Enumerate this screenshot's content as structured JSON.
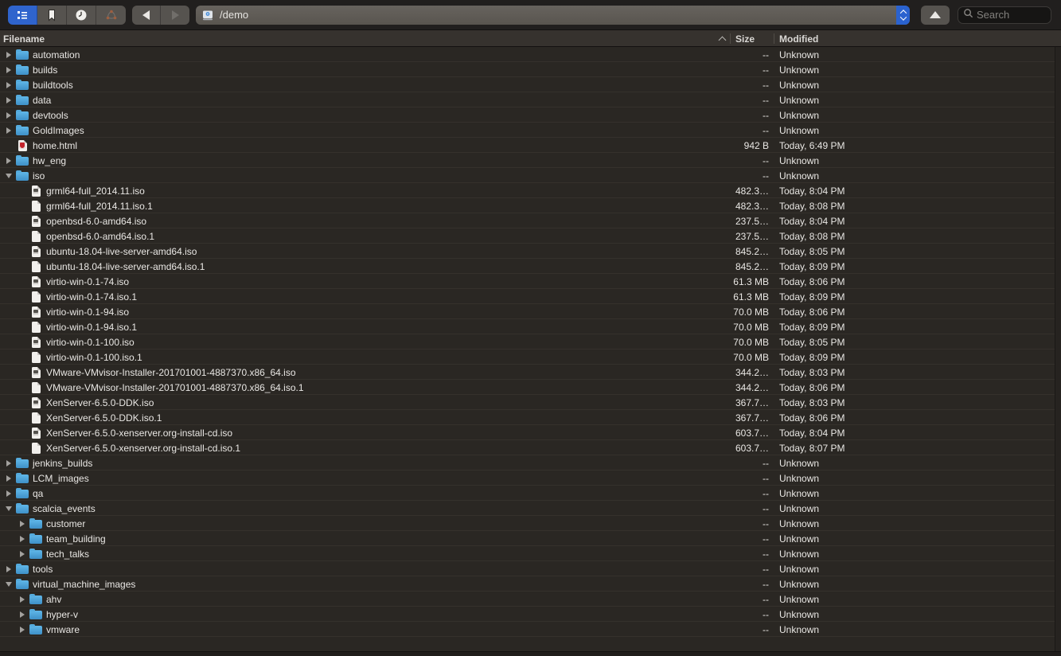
{
  "toolbar": {
    "view_buttons": [
      {
        "name": "outline-view",
        "selected": true
      },
      {
        "name": "bookmarks-view",
        "selected": false
      },
      {
        "name": "history-view",
        "selected": false
      },
      {
        "name": "network-view",
        "selected": false
      }
    ],
    "back_enabled": true,
    "forward_enabled": false,
    "path_value": "/demo",
    "search_placeholder": "Search"
  },
  "colors": {
    "accent_blue": "#2f64cd",
    "folder_blue": "#4aa3d8",
    "row_background": "#2a2723",
    "toolbar_background": "#211f1e",
    "html_badge_red": "#c4232b"
  },
  "table": {
    "columns": [
      {
        "label": "Filename",
        "sort": "ascending"
      },
      {
        "label": "Size",
        "sort": null
      },
      {
        "label": "Modified",
        "sort": null
      }
    ],
    "rows": [
      {
        "name": "automation",
        "icon": "folder",
        "level": 0,
        "expander": "collapsed",
        "size": "--",
        "modified": "Unknown"
      },
      {
        "name": "builds",
        "icon": "folder",
        "level": 0,
        "expander": "collapsed",
        "size": "--",
        "modified": "Unknown"
      },
      {
        "name": "buildtools",
        "icon": "folder",
        "level": 0,
        "expander": "collapsed",
        "size": "--",
        "modified": "Unknown"
      },
      {
        "name": "data",
        "icon": "folder",
        "level": 0,
        "expander": "collapsed",
        "size": "--",
        "modified": "Unknown"
      },
      {
        "name": "devtools",
        "icon": "folder",
        "level": 0,
        "expander": "collapsed",
        "size": "--",
        "modified": "Unknown"
      },
      {
        "name": "GoldImages",
        "icon": "folder",
        "level": 0,
        "expander": "collapsed",
        "size": "--",
        "modified": "Unknown"
      },
      {
        "name": "home.html",
        "icon": "file-html",
        "level": 0,
        "expander": null,
        "size": "942 B",
        "modified": "Today, 6:49 PM"
      },
      {
        "name": "hw_eng",
        "icon": "folder",
        "level": 0,
        "expander": "collapsed",
        "size": "--",
        "modified": "Unknown"
      },
      {
        "name": "iso",
        "icon": "folder",
        "level": 0,
        "expander": "expanded",
        "size": "--",
        "modified": "Unknown"
      },
      {
        "name": "grml64-full_2014.11.iso",
        "icon": "file-iso",
        "level": 1,
        "expander": null,
        "size": "482.3…",
        "modified": "Today, 8:04 PM"
      },
      {
        "name": "grml64-full_2014.11.iso.1",
        "icon": "file-plain",
        "level": 1,
        "expander": null,
        "size": "482.3…",
        "modified": "Today, 8:08 PM"
      },
      {
        "name": "openbsd-6.0-amd64.iso",
        "icon": "file-iso",
        "level": 1,
        "expander": null,
        "size": "237.5…",
        "modified": "Today, 8:04 PM"
      },
      {
        "name": "openbsd-6.0-amd64.iso.1",
        "icon": "file-plain",
        "level": 1,
        "expander": null,
        "size": "237.5…",
        "modified": "Today, 8:08 PM"
      },
      {
        "name": "ubuntu-18.04-live-server-amd64.iso",
        "icon": "file-iso",
        "level": 1,
        "expander": null,
        "size": "845.2…",
        "modified": "Today, 8:05 PM"
      },
      {
        "name": "ubuntu-18.04-live-server-amd64.iso.1",
        "icon": "file-plain",
        "level": 1,
        "expander": null,
        "size": "845.2…",
        "modified": "Today, 8:09 PM"
      },
      {
        "name": "virtio-win-0.1-74.iso",
        "icon": "file-iso",
        "level": 1,
        "expander": null,
        "size": "61.3 MB",
        "modified": "Today, 8:06 PM"
      },
      {
        "name": "virtio-win-0.1-74.iso.1",
        "icon": "file-plain",
        "level": 1,
        "expander": null,
        "size": "61.3 MB",
        "modified": "Today, 8:09 PM"
      },
      {
        "name": "virtio-win-0.1-94.iso",
        "icon": "file-iso",
        "level": 1,
        "expander": null,
        "size": "70.0 MB",
        "modified": "Today, 8:06 PM"
      },
      {
        "name": "virtio-win-0.1-94.iso.1",
        "icon": "file-plain",
        "level": 1,
        "expander": null,
        "size": "70.0 MB",
        "modified": "Today, 8:09 PM"
      },
      {
        "name": "virtio-win-0.1-100.iso",
        "icon": "file-iso",
        "level": 1,
        "expander": null,
        "size": "70.0 MB",
        "modified": "Today, 8:05 PM"
      },
      {
        "name": "virtio-win-0.1-100.iso.1",
        "icon": "file-plain",
        "level": 1,
        "expander": null,
        "size": "70.0 MB",
        "modified": "Today, 8:09 PM"
      },
      {
        "name": "VMware-VMvisor-Installer-201701001-4887370.x86_64.iso",
        "icon": "file-iso",
        "level": 1,
        "expander": null,
        "size": "344.2…",
        "modified": "Today, 8:03 PM"
      },
      {
        "name": "VMware-VMvisor-Installer-201701001-4887370.x86_64.iso.1",
        "icon": "file-plain",
        "level": 1,
        "expander": null,
        "size": "344.2…",
        "modified": "Today, 8:06 PM"
      },
      {
        "name": "XenServer-6.5.0-DDK.iso",
        "icon": "file-iso",
        "level": 1,
        "expander": null,
        "size": "367.7…",
        "modified": "Today, 8:03 PM"
      },
      {
        "name": "XenServer-6.5.0-DDK.iso.1",
        "icon": "file-plain",
        "level": 1,
        "expander": null,
        "size": "367.7…",
        "modified": "Today, 8:06 PM"
      },
      {
        "name": "XenServer-6.5.0-xenserver.org-install-cd.iso",
        "icon": "file-iso",
        "level": 1,
        "expander": null,
        "size": "603.7…",
        "modified": "Today, 8:04 PM"
      },
      {
        "name": "XenServer-6.5.0-xenserver.org-install-cd.iso.1",
        "icon": "file-plain",
        "level": 1,
        "expander": null,
        "size": "603.7…",
        "modified": "Today, 8:07 PM"
      },
      {
        "name": "jenkins_builds",
        "icon": "folder",
        "level": 0,
        "expander": "collapsed",
        "size": "--",
        "modified": "Unknown"
      },
      {
        "name": "LCM_images",
        "icon": "folder",
        "level": 0,
        "expander": "collapsed",
        "size": "--",
        "modified": "Unknown"
      },
      {
        "name": "qa",
        "icon": "folder",
        "level": 0,
        "expander": "collapsed",
        "size": "--",
        "modified": "Unknown"
      },
      {
        "name": "scalcia_events",
        "icon": "folder",
        "level": 0,
        "expander": "expanded",
        "size": "--",
        "modified": "Unknown"
      },
      {
        "name": "customer",
        "icon": "folder",
        "level": 1,
        "expander": "collapsed",
        "size": "--",
        "modified": "Unknown"
      },
      {
        "name": "team_building",
        "icon": "folder",
        "level": 1,
        "expander": "collapsed",
        "size": "--",
        "modified": "Unknown"
      },
      {
        "name": "tech_talks",
        "icon": "folder",
        "level": 1,
        "expander": "collapsed",
        "size": "--",
        "modified": "Unknown"
      },
      {
        "name": "tools",
        "icon": "folder",
        "level": 0,
        "expander": "collapsed",
        "size": "--",
        "modified": "Unknown"
      },
      {
        "name": "virtual_machine_images",
        "icon": "folder",
        "level": 0,
        "expander": "expanded",
        "size": "--",
        "modified": "Unknown"
      },
      {
        "name": "ahv",
        "icon": "folder",
        "level": 1,
        "expander": "collapsed",
        "size": "--",
        "modified": "Unknown"
      },
      {
        "name": "hyper-v",
        "icon": "folder",
        "level": 1,
        "expander": "collapsed",
        "size": "--",
        "modified": "Unknown"
      },
      {
        "name": "vmware",
        "icon": "folder",
        "level": 1,
        "expander": "collapsed",
        "size": "--",
        "modified": "Unknown"
      }
    ]
  }
}
